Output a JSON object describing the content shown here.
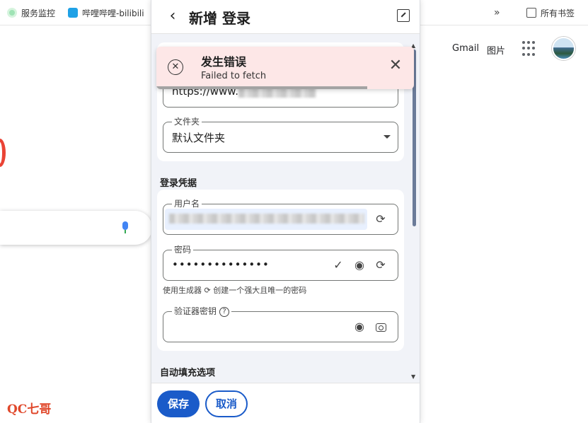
{
  "bookmarks": {
    "items": [
      {
        "label": "服务监控",
        "icon": "monitor-icon"
      },
      {
        "label": "哔哩哔哩-bilibili",
        "icon": "bilibili-icon"
      }
    ],
    "overflow_icon": "chevron-double-right-icon",
    "folder_label": "所有书签"
  },
  "google": {
    "gmail_label": "Gmail",
    "images_label": "图片",
    "watermark": "QC七哥"
  },
  "popup": {
    "title": "新增 登录",
    "url_value": "https://www.",
    "folder_label": "文件夹",
    "folder_value": "默认文件夹",
    "credentials_section": "登录凭据",
    "username_label": "用户名",
    "password_label": "密码",
    "password_value": "••••••••••••••",
    "generator_hint": "使用生成器 ⟳ 创建一个强大且唯一的密码",
    "totp_label": "验证器密钥",
    "totp_help": "?",
    "autofill_section": "自动填充选项",
    "save_label": "保存",
    "cancel_label": "取消"
  },
  "toast": {
    "title": "发生错误",
    "message": "Failed to fetch",
    "progress": 0.82,
    "status_color": "#fde7e7"
  },
  "colors": {
    "primary": "#1a5bc9",
    "autofill_bg": "#e8f0fe"
  }
}
